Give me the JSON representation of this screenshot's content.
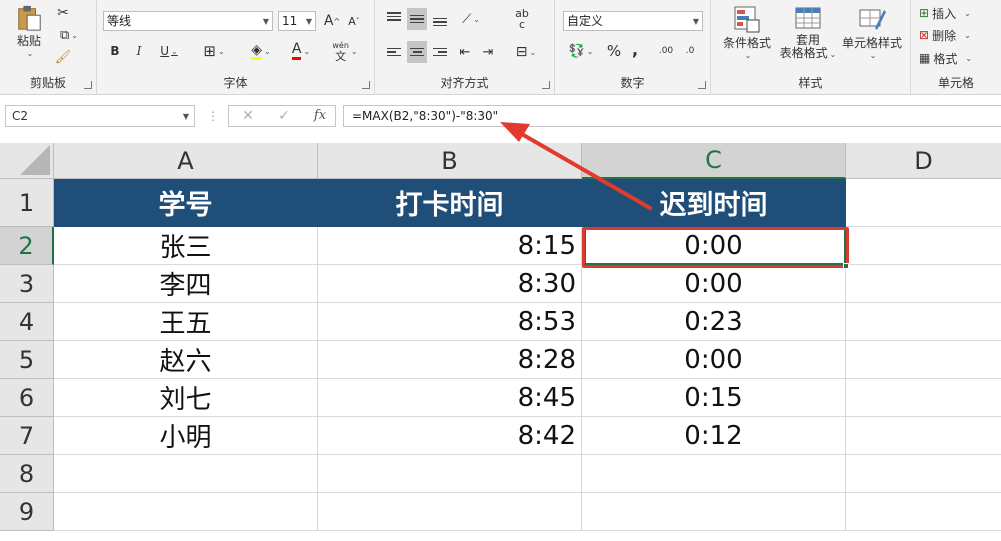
{
  "ribbon": {
    "clipboard": {
      "label": "剪贴板",
      "paste_label": "粘贴"
    },
    "font": {
      "label": "字体",
      "font_name": "等线",
      "font_size": "11",
      "bold": "B",
      "italic": "I",
      "underline": "U",
      "grow": "A",
      "shrink": "A",
      "font_color": "A",
      "phonetic_top": "wén",
      "phonetic_bottom": "文"
    },
    "alignment": {
      "label": "对齐方式",
      "wrap": "ab",
      "wrap2": "c"
    },
    "number": {
      "label": "数字",
      "format": "自定义",
      "percent": "%",
      "comma": ",",
      "inc_dec": ".00",
      "dec_dec": ".0"
    },
    "styles": {
      "label": "样式",
      "conditional": "条件格式",
      "table_line1": "套用",
      "table_line2": "表格格式",
      "cell_styles": "单元格样式"
    },
    "cells": {
      "label": "单元格",
      "insert": "插入",
      "delete": "删除",
      "format": "格式"
    }
  },
  "formula_bar": {
    "name_box": "C2",
    "formula": "=MAX(B2,\"8:30\")-\"8:30\"",
    "cancel": "✕",
    "enter": "✓",
    "fx": "fx"
  },
  "grid": {
    "columns": [
      "A",
      "B",
      "C",
      "D"
    ],
    "rows": [
      "1",
      "2",
      "3",
      "4",
      "5",
      "6",
      "7",
      "8",
      "9"
    ],
    "header": {
      "a": "学号",
      "b": "打卡时间",
      "c": "迟到时间"
    },
    "data": [
      {
        "a": "张三",
        "b": "8:15",
        "c": "0:00"
      },
      {
        "a": "李四",
        "b": "8:30",
        "c": "0:00"
      },
      {
        "a": "王五",
        "b": "8:53",
        "c": "0:23"
      },
      {
        "a": "赵六",
        "b": "8:28",
        "c": "0:00"
      },
      {
        "a": "刘七",
        "b": "8:45",
        "c": "0:15"
      },
      {
        "a": "小明",
        "b": "8:42",
        "c": "0:12"
      }
    ]
  },
  "colors": {
    "header_fill": "#1f4e79",
    "accent": "#217346",
    "highlight": "#d83b2f"
  }
}
